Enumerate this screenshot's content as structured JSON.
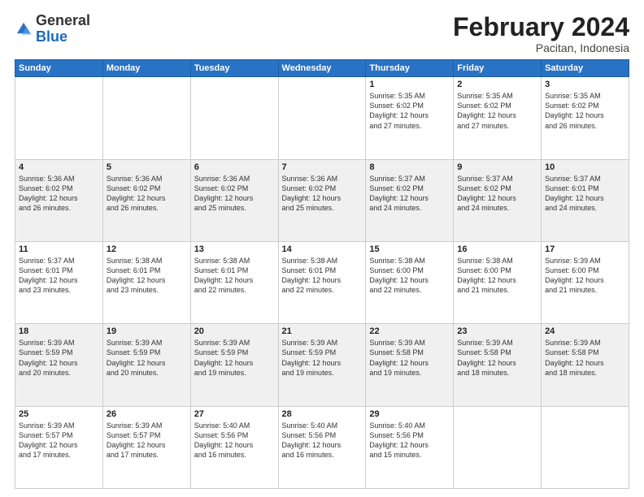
{
  "logo": {
    "general": "General",
    "blue": "Blue"
  },
  "title": "February 2024",
  "subtitle": "Pacitan, Indonesia",
  "days_header": [
    "Sunday",
    "Monday",
    "Tuesday",
    "Wednesday",
    "Thursday",
    "Friday",
    "Saturday"
  ],
  "weeks": [
    [
      {
        "num": "",
        "info": ""
      },
      {
        "num": "",
        "info": ""
      },
      {
        "num": "",
        "info": ""
      },
      {
        "num": "",
        "info": ""
      },
      {
        "num": "1",
        "info": "Sunrise: 5:35 AM\nSunset: 6:02 PM\nDaylight: 12 hours\nand 27 minutes."
      },
      {
        "num": "2",
        "info": "Sunrise: 5:35 AM\nSunset: 6:02 PM\nDaylight: 12 hours\nand 27 minutes."
      },
      {
        "num": "3",
        "info": "Sunrise: 5:35 AM\nSunset: 6:02 PM\nDaylight: 12 hours\nand 26 minutes."
      }
    ],
    [
      {
        "num": "4",
        "info": "Sunrise: 5:36 AM\nSunset: 6:02 PM\nDaylight: 12 hours\nand 26 minutes."
      },
      {
        "num": "5",
        "info": "Sunrise: 5:36 AM\nSunset: 6:02 PM\nDaylight: 12 hours\nand 26 minutes."
      },
      {
        "num": "6",
        "info": "Sunrise: 5:36 AM\nSunset: 6:02 PM\nDaylight: 12 hours\nand 25 minutes."
      },
      {
        "num": "7",
        "info": "Sunrise: 5:36 AM\nSunset: 6:02 PM\nDaylight: 12 hours\nand 25 minutes."
      },
      {
        "num": "8",
        "info": "Sunrise: 5:37 AM\nSunset: 6:02 PM\nDaylight: 12 hours\nand 24 minutes."
      },
      {
        "num": "9",
        "info": "Sunrise: 5:37 AM\nSunset: 6:02 PM\nDaylight: 12 hours\nand 24 minutes."
      },
      {
        "num": "10",
        "info": "Sunrise: 5:37 AM\nSunset: 6:01 PM\nDaylight: 12 hours\nand 24 minutes."
      }
    ],
    [
      {
        "num": "11",
        "info": "Sunrise: 5:37 AM\nSunset: 6:01 PM\nDaylight: 12 hours\nand 23 minutes."
      },
      {
        "num": "12",
        "info": "Sunrise: 5:38 AM\nSunset: 6:01 PM\nDaylight: 12 hours\nand 23 minutes."
      },
      {
        "num": "13",
        "info": "Sunrise: 5:38 AM\nSunset: 6:01 PM\nDaylight: 12 hours\nand 22 minutes."
      },
      {
        "num": "14",
        "info": "Sunrise: 5:38 AM\nSunset: 6:01 PM\nDaylight: 12 hours\nand 22 minutes."
      },
      {
        "num": "15",
        "info": "Sunrise: 5:38 AM\nSunset: 6:00 PM\nDaylight: 12 hours\nand 22 minutes."
      },
      {
        "num": "16",
        "info": "Sunrise: 5:38 AM\nSunset: 6:00 PM\nDaylight: 12 hours\nand 21 minutes."
      },
      {
        "num": "17",
        "info": "Sunrise: 5:39 AM\nSunset: 6:00 PM\nDaylight: 12 hours\nand 21 minutes."
      }
    ],
    [
      {
        "num": "18",
        "info": "Sunrise: 5:39 AM\nSunset: 5:59 PM\nDaylight: 12 hours\nand 20 minutes."
      },
      {
        "num": "19",
        "info": "Sunrise: 5:39 AM\nSunset: 5:59 PM\nDaylight: 12 hours\nand 20 minutes."
      },
      {
        "num": "20",
        "info": "Sunrise: 5:39 AM\nSunset: 5:59 PM\nDaylight: 12 hours\nand 19 minutes."
      },
      {
        "num": "21",
        "info": "Sunrise: 5:39 AM\nSunset: 5:59 PM\nDaylight: 12 hours\nand 19 minutes."
      },
      {
        "num": "22",
        "info": "Sunrise: 5:39 AM\nSunset: 5:58 PM\nDaylight: 12 hours\nand 19 minutes."
      },
      {
        "num": "23",
        "info": "Sunrise: 5:39 AM\nSunset: 5:58 PM\nDaylight: 12 hours\nand 18 minutes."
      },
      {
        "num": "24",
        "info": "Sunrise: 5:39 AM\nSunset: 5:58 PM\nDaylight: 12 hours\nand 18 minutes."
      }
    ],
    [
      {
        "num": "25",
        "info": "Sunrise: 5:39 AM\nSunset: 5:57 PM\nDaylight: 12 hours\nand 17 minutes."
      },
      {
        "num": "26",
        "info": "Sunrise: 5:39 AM\nSunset: 5:57 PM\nDaylight: 12 hours\nand 17 minutes."
      },
      {
        "num": "27",
        "info": "Sunrise: 5:40 AM\nSunset: 5:56 PM\nDaylight: 12 hours\nand 16 minutes."
      },
      {
        "num": "28",
        "info": "Sunrise: 5:40 AM\nSunset: 5:56 PM\nDaylight: 12 hours\nand 16 minutes."
      },
      {
        "num": "29",
        "info": "Sunrise: 5:40 AM\nSunset: 5:56 PM\nDaylight: 12 hours\nand 15 minutes."
      },
      {
        "num": "",
        "info": ""
      },
      {
        "num": "",
        "info": ""
      }
    ]
  ]
}
